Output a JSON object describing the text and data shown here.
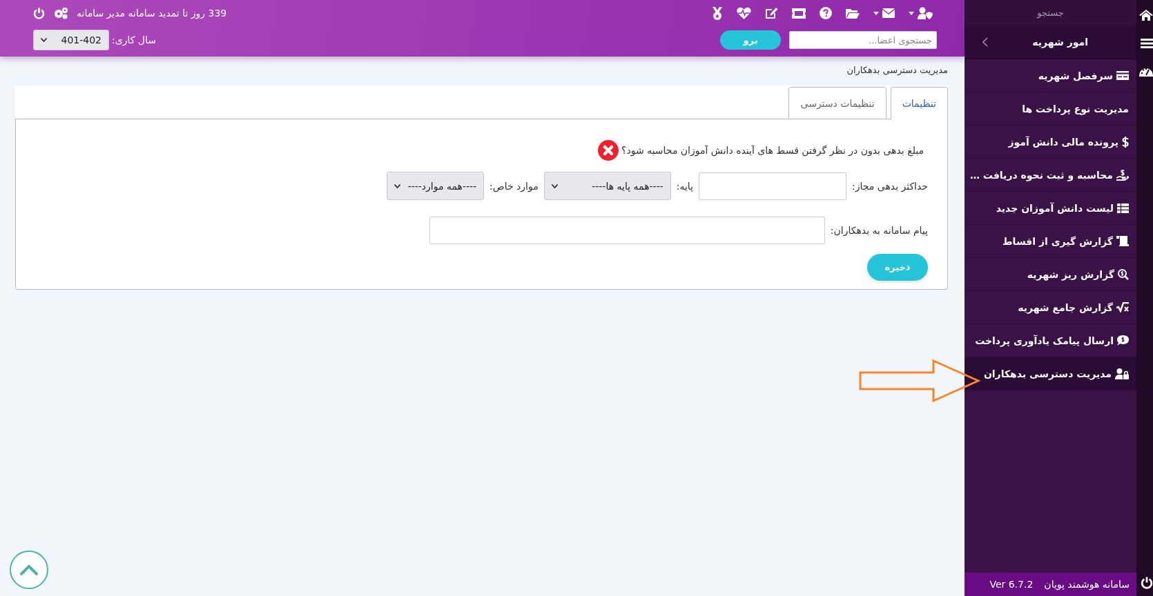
{
  "topbar": {
    "subscription": "339 روز تا تمدید سامانه مدیر سامانه",
    "year_label": "سال کاری:",
    "year_value": "401-402",
    "search": {
      "placeholder": "جستجوی اعضا..."
    },
    "go_button": "برو"
  },
  "page_title": "مدیریت دسترسی بدهکاران",
  "tabs": [
    {
      "label": "تنظیمات",
      "selected": true
    },
    {
      "label": "تنظیمات دسترسی",
      "selected": false
    }
  ],
  "form": {
    "question": "مبلغ بدهی بدون در نظر گرفتن قسط های آینده دانش آموزان محاسبه شود؟",
    "enabled": false,
    "max_debt_label": "حداکثر بدهی مجاز:",
    "grade_label": "پایه:",
    "grade_value": "----همه پایه ها----",
    "special_label": "موارد خاص:",
    "special_value": "----همه موارد----",
    "message_label": "پیام سامانه به بدهکاران:",
    "save_button": "ذخیره"
  },
  "sidebar": {
    "search_label": "جستجو",
    "section": "امور شهریه",
    "items": [
      {
        "label": "سرفصل شهریه",
        "selected": false
      },
      {
        "label": "مدیریت نوع پرداخت ها",
        "selected": false
      },
      {
        "label": "پرونده مالی دانش آموز",
        "selected": false
      },
      {
        "label": "محاسبه و ثبت نحوه دریافت …",
        "selected": false
      },
      {
        "label": "لیست دانش آموزان جدید",
        "selected": false
      },
      {
        "label": "گزارش گیری از اقساط",
        "selected": false
      },
      {
        "label": "گزارش ریز شهریه",
        "selected": false
      },
      {
        "label": "گزارش جامع شهریه",
        "selected": false
      },
      {
        "label": "ارسال پیامک یادآوری پرداخت",
        "selected": false
      },
      {
        "label": "مدیریت دسترسی بدهکاران",
        "selected": true
      }
    ],
    "footer": {
      "product": "سامانه هوشمند پویان",
      "version": "Ver 6.7.2"
    }
  }
}
